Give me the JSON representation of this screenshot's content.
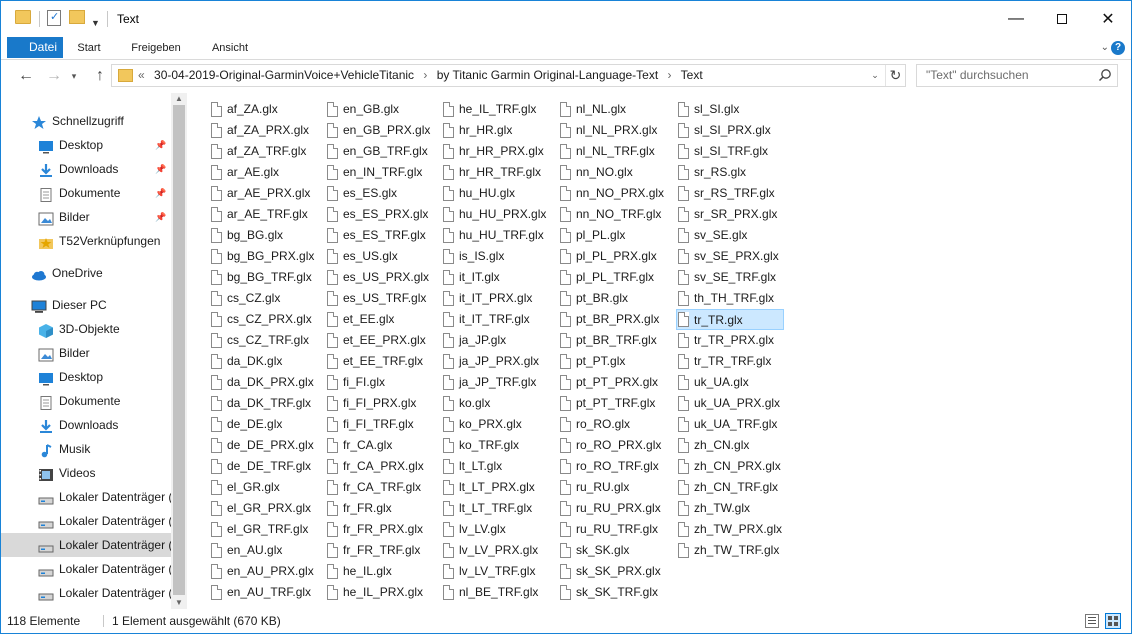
{
  "window": {
    "title": "Text",
    "controls": {
      "minimize": "—",
      "maximize": "",
      "close": "✕"
    }
  },
  "ribbon": {
    "tabs": [
      "Datei",
      "Start",
      "Freigeben",
      "Ansicht"
    ],
    "expand_icon": "chevron-down-icon",
    "help_label": "?"
  },
  "address": {
    "crumbs": [
      "«",
      "30-04-2019-Original-GarminVoice+VehicleTitanic",
      "›",
      "by Titanic Garmin Original-Language-Text",
      "›",
      "Text"
    ],
    "search_placeholder": "\"Text\" durchsuchen"
  },
  "sidebar": {
    "items": [
      {
        "label": "Schnellzugriff",
        "icon": "star-icon",
        "indent": 1,
        "pinned": false
      },
      {
        "label": "Desktop",
        "icon": "desktop-icon",
        "indent": 2,
        "pinned": true
      },
      {
        "label": "Downloads",
        "icon": "download-icon",
        "indent": 2,
        "pinned": true
      },
      {
        "label": "Dokumente",
        "icon": "document-icon",
        "indent": 2,
        "pinned": true
      },
      {
        "label": "Bilder",
        "icon": "pictures-icon",
        "indent": 2,
        "pinned": true
      },
      {
        "label": "T52Verknüpfungen",
        "icon": "star-folder-icon",
        "indent": 2,
        "pinned": false
      },
      {
        "label": "OneDrive",
        "icon": "cloud-icon",
        "indent": 1,
        "pinned": false
      },
      {
        "label": "Dieser PC",
        "icon": "pc-icon",
        "indent": 1,
        "pinned": false
      },
      {
        "label": "3D-Objekte",
        "icon": "cube-icon",
        "indent": 2,
        "pinned": false
      },
      {
        "label": "Bilder",
        "icon": "pictures-icon",
        "indent": 2,
        "pinned": false
      },
      {
        "label": "Desktop",
        "icon": "desktop-icon",
        "indent": 2,
        "pinned": false
      },
      {
        "label": "Dokumente",
        "icon": "document-icon",
        "indent": 2,
        "pinned": false
      },
      {
        "label": "Downloads",
        "icon": "download-icon",
        "indent": 2,
        "pinned": false
      },
      {
        "label": "Musik",
        "icon": "music-icon",
        "indent": 2,
        "pinned": false
      },
      {
        "label": "Videos",
        "icon": "video-icon",
        "indent": 2,
        "pinned": false
      },
      {
        "label": "Lokaler Datenträger (",
        "icon": "drive-icon",
        "indent": 2,
        "pinned": false
      },
      {
        "label": "Lokaler Datenträger (",
        "icon": "drive-icon",
        "indent": 2,
        "pinned": false
      },
      {
        "label": "Lokaler Datenträger (",
        "icon": "drive-icon",
        "indent": 2,
        "pinned": false,
        "selected": true
      },
      {
        "label": "Lokaler Datenträger (",
        "icon": "drive-icon",
        "indent": 2,
        "pinned": false
      },
      {
        "label": "Lokaler Datenträger (",
        "icon": "drive-icon",
        "indent": 2,
        "pinned": false
      }
    ]
  },
  "files": {
    "columns": [
      [
        "af_ZA.glx",
        "af_ZA_PRX.glx",
        "af_ZA_TRF.glx",
        "ar_AE.glx",
        "ar_AE_PRX.glx",
        "ar_AE_TRF.glx",
        "bg_BG.glx",
        "bg_BG_PRX.glx",
        "bg_BG_TRF.glx",
        "cs_CZ.glx",
        "cs_CZ_PRX.glx",
        "cs_CZ_TRF.glx",
        "da_DK.glx",
        "da_DK_PRX.glx",
        "da_DK_TRF.glx",
        "de_DE.glx",
        "de_DE_PRX.glx",
        "de_DE_TRF.glx",
        "el_GR.glx",
        "el_GR_PRX.glx",
        "el_GR_TRF.glx",
        "en_AU.glx",
        "en_AU_PRX.glx",
        "en_AU_TRF.glx"
      ],
      [
        "en_GB.glx",
        "en_GB_PRX.glx",
        "en_GB_TRF.glx",
        "en_IN_TRF.glx",
        "es_ES.glx",
        "es_ES_PRX.glx",
        "es_ES_TRF.glx",
        "es_US.glx",
        "es_US_PRX.glx",
        "es_US_TRF.glx",
        "et_EE.glx",
        "et_EE_PRX.glx",
        "et_EE_TRF.glx",
        "fi_FI.glx",
        "fi_FI_PRX.glx",
        "fi_FI_TRF.glx",
        "fr_CA.glx",
        "fr_CA_PRX.glx",
        "fr_CA_TRF.glx",
        "fr_FR.glx",
        "fr_FR_PRX.glx",
        "fr_FR_TRF.glx",
        "he_IL.glx",
        "he_IL_PRX.glx"
      ],
      [
        "he_IL_TRF.glx",
        "hr_HR.glx",
        "hr_HR_PRX.glx",
        "hr_HR_TRF.glx",
        "hu_HU.glx",
        "hu_HU_PRX.glx",
        "hu_HU_TRF.glx",
        "is_IS.glx",
        "it_IT.glx",
        "it_IT_PRX.glx",
        "it_IT_TRF.glx",
        "ja_JP.glx",
        "ja_JP_PRX.glx",
        "ja_JP_TRF.glx",
        "ko.glx",
        "ko_PRX.glx",
        "ko_TRF.glx",
        "lt_LT.glx",
        "lt_LT_PRX.glx",
        "lt_LT_TRF.glx",
        "lv_LV.glx",
        "lv_LV_PRX.glx",
        "lv_LV_TRF.glx",
        "nl_BE_TRF.glx"
      ],
      [
        "nl_NL.glx",
        "nl_NL_PRX.glx",
        "nl_NL_TRF.glx",
        "nn_NO.glx",
        "nn_NO_PRX.glx",
        "nn_NO_TRF.glx",
        "pl_PL.glx",
        "pl_PL_PRX.glx",
        "pl_PL_TRF.glx",
        "pt_BR.glx",
        "pt_BR_PRX.glx",
        "pt_BR_TRF.glx",
        "pt_PT.glx",
        "pt_PT_PRX.glx",
        "pt_PT_TRF.glx",
        "ro_RO.glx",
        "ro_RO_PRX.glx",
        "ro_RO_TRF.glx",
        "ru_RU.glx",
        "ru_RU_PRX.glx",
        "ru_RU_TRF.glx",
        "sk_SK.glx",
        "sk_SK_PRX.glx",
        "sk_SK_TRF.glx"
      ],
      [
        "sl_SI.glx",
        "sl_SI_PRX.glx",
        "sl_SI_TRF.glx",
        "sr_RS.glx",
        "sr_RS_TRF.glx",
        "sr_SR_PRX.glx",
        "sv_SE.glx",
        "sv_SE_PRX.glx",
        "sv_SE_TRF.glx",
        "th_TH_TRF.glx",
        "tr_TR.glx",
        "tr_TR_PRX.glx",
        "tr_TR_TRF.glx",
        "uk_UA.glx",
        "uk_UA_PRX.glx",
        "uk_UA_TRF.glx",
        "zh_CN.glx",
        "zh_CN_PRX.glx",
        "zh_CN_TRF.glx",
        "zh_TW.glx",
        "zh_TW_PRX.glx",
        "zh_TW_TRF.glx"
      ]
    ],
    "selected": "tr_TR.glx"
  },
  "status": {
    "count": "118 Elemente",
    "selection": "1 Element ausgewählt (670 KB)"
  },
  "colors": {
    "accent": "#1979ca",
    "selection_bg": "#cce8ff",
    "selection_border": "#99d1ff",
    "sidebar_selected": "#d9d9d9",
    "folder": "#f2c75c"
  }
}
